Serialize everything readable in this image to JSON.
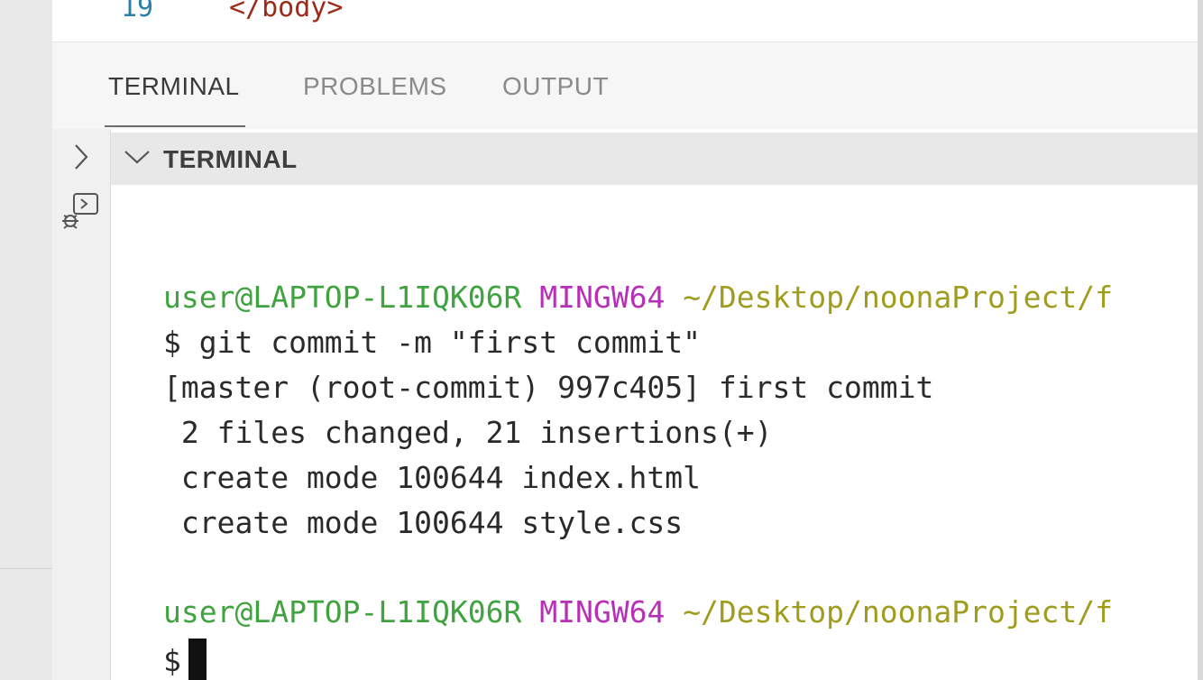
{
  "editor": {
    "line_number": "19",
    "code": "</body>"
  },
  "panel": {
    "tabs": [
      {
        "label": "TERMINAL",
        "active": true
      },
      {
        "label": "PROBLEMS",
        "active": false
      },
      {
        "label": "OUTPUT",
        "active": false
      }
    ]
  },
  "terminal": {
    "header_title": "TERMINAL",
    "prompt1": {
      "user": "user@LAPTOP-L1IQK06R",
      "env": "MINGW64",
      "path": "~/Desktop/noonaProject/f"
    },
    "cmd": "$ git commit -m \"first commit\"",
    "output": [
      "[master (root-commit) 997c405] first commit",
      " 2 files changed, 21 insertions(+)",
      " create mode 100644 index.html",
      " create mode 100644 style.css"
    ],
    "prompt2": {
      "user": "user@LAPTOP-L1IQK06R",
      "env": "MINGW64",
      "path": "~/Desktop/noonaProject/f"
    },
    "input_prompt": "$"
  },
  "icons": [
    "chevron-right-icon",
    "debug-console-icon",
    "chevron-down-icon"
  ]
}
